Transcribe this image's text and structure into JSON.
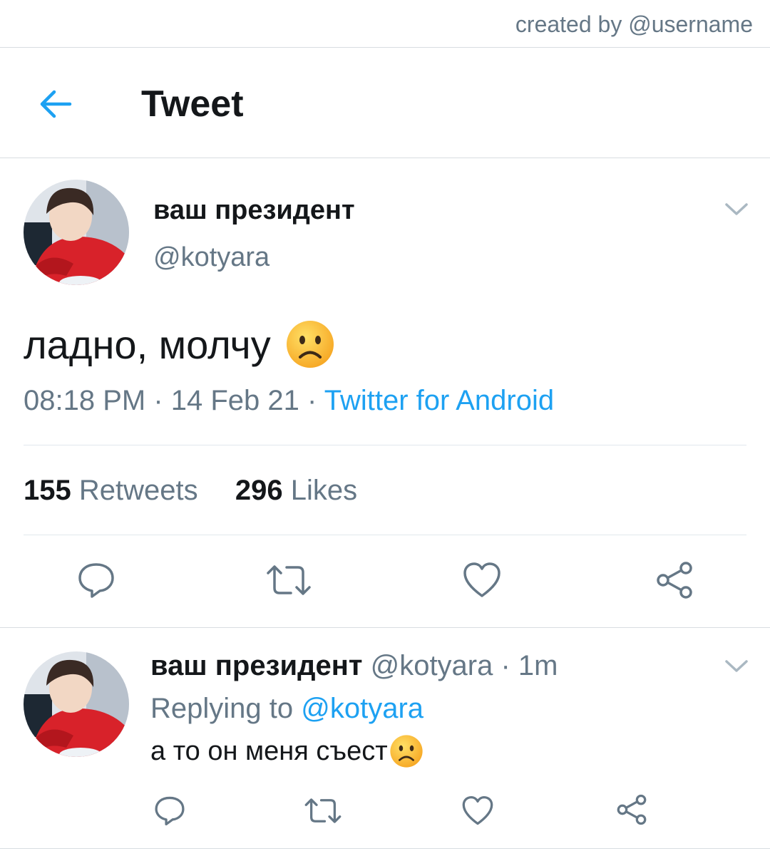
{
  "credit": "created by @username",
  "header": {
    "title": "Tweet",
    "back_icon": "arrow-left-icon"
  },
  "colors": {
    "accent": "#1da1f2",
    "muted": "#657786",
    "text": "#14171a",
    "divider": "#e1e8ed"
  },
  "tweet": {
    "author_name": "ваш президент",
    "author_handle": "@kotyara",
    "text": "ладно, молчу",
    "emoji": "frowning-face",
    "time": "08:18 PM",
    "sep1": " · ",
    "date": "14 Feb 21",
    "sep2": " · ",
    "source": "Twitter for Android",
    "retweets_count": "155",
    "retweets_label": "Retweets",
    "likes_count": "296",
    "likes_label": "Likes"
  },
  "reply": {
    "author_name": "ваш президент",
    "author_handle": "@kotyara",
    "dot": " · ",
    "time_ago": "1m",
    "replying_to_label": "Replying to",
    "replying_to_handle": "@kotyara",
    "text": "а то он меня съест",
    "emoji": "frowning-face"
  },
  "actions": [
    "reply-icon",
    "retweet-icon",
    "like-icon",
    "share-icon"
  ]
}
